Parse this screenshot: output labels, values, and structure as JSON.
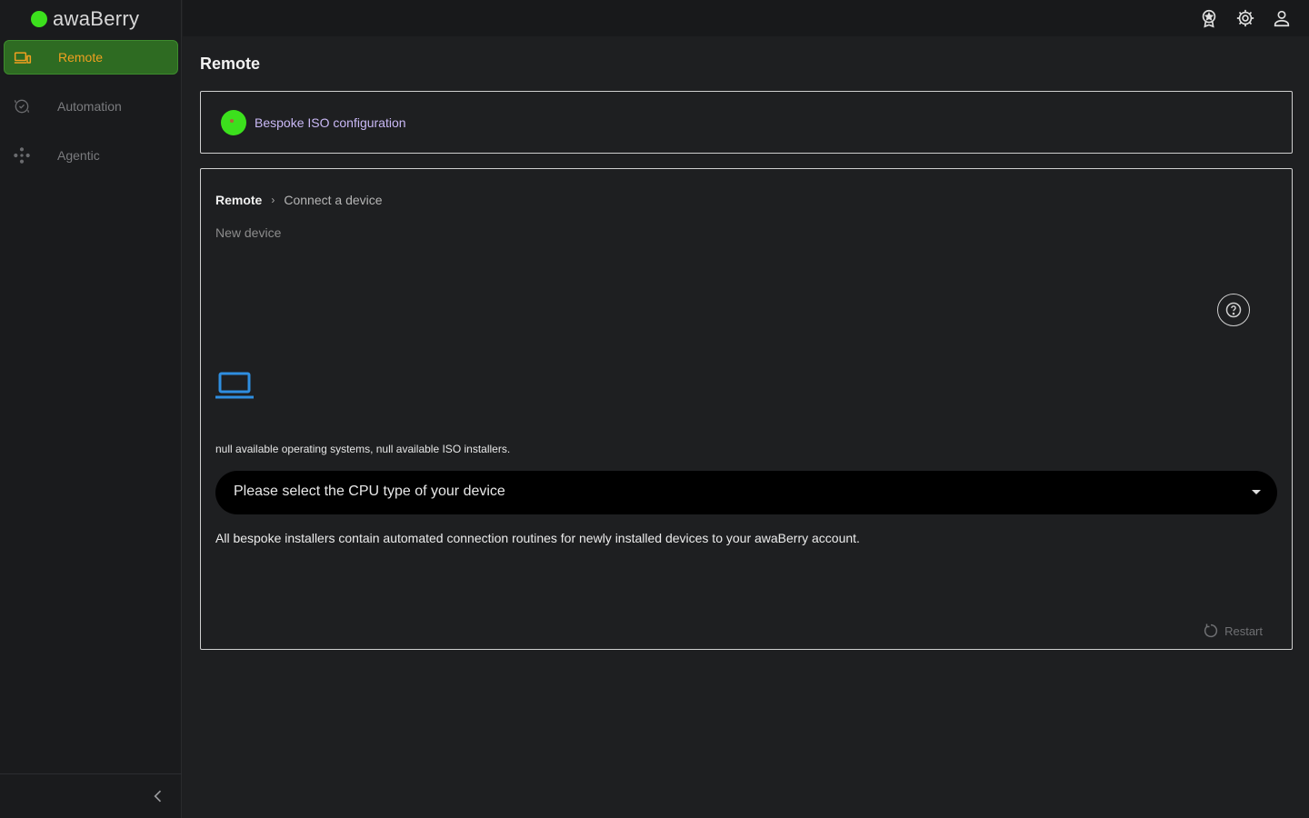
{
  "app": {
    "name": "awaBerry",
    "accent": "#3ce01d",
    "active_nav_bg": "#2e6b22",
    "active_nav_text": "#f0a020"
  },
  "sidebar": {
    "items": [
      {
        "label": "Remote",
        "icon": "devices-icon",
        "active": true
      },
      {
        "label": "Automation",
        "icon": "automation-icon",
        "active": false
      },
      {
        "label": "Agentic",
        "icon": "agentic-icon",
        "active": false
      }
    ],
    "collapse_icon": "chevron-left-icon"
  },
  "topbar": {
    "icons": [
      "award-icon",
      "gear-icon",
      "user-icon"
    ]
  },
  "main": {
    "title": "Remote",
    "iso_card": {
      "label": "Bespoke ISO configuration"
    },
    "breadcrumb": {
      "root": "Remote",
      "current": "Connect a device"
    },
    "subtitle": "New device",
    "os_info": "null available operating systems, null available ISO installers.",
    "cpu_select": {
      "placeholder": "Please select the CPU type of your device"
    },
    "description": "All bespoke installers contain automated connection routines for newly installed devices to your awaBerry account.",
    "restart_label": "Restart"
  }
}
